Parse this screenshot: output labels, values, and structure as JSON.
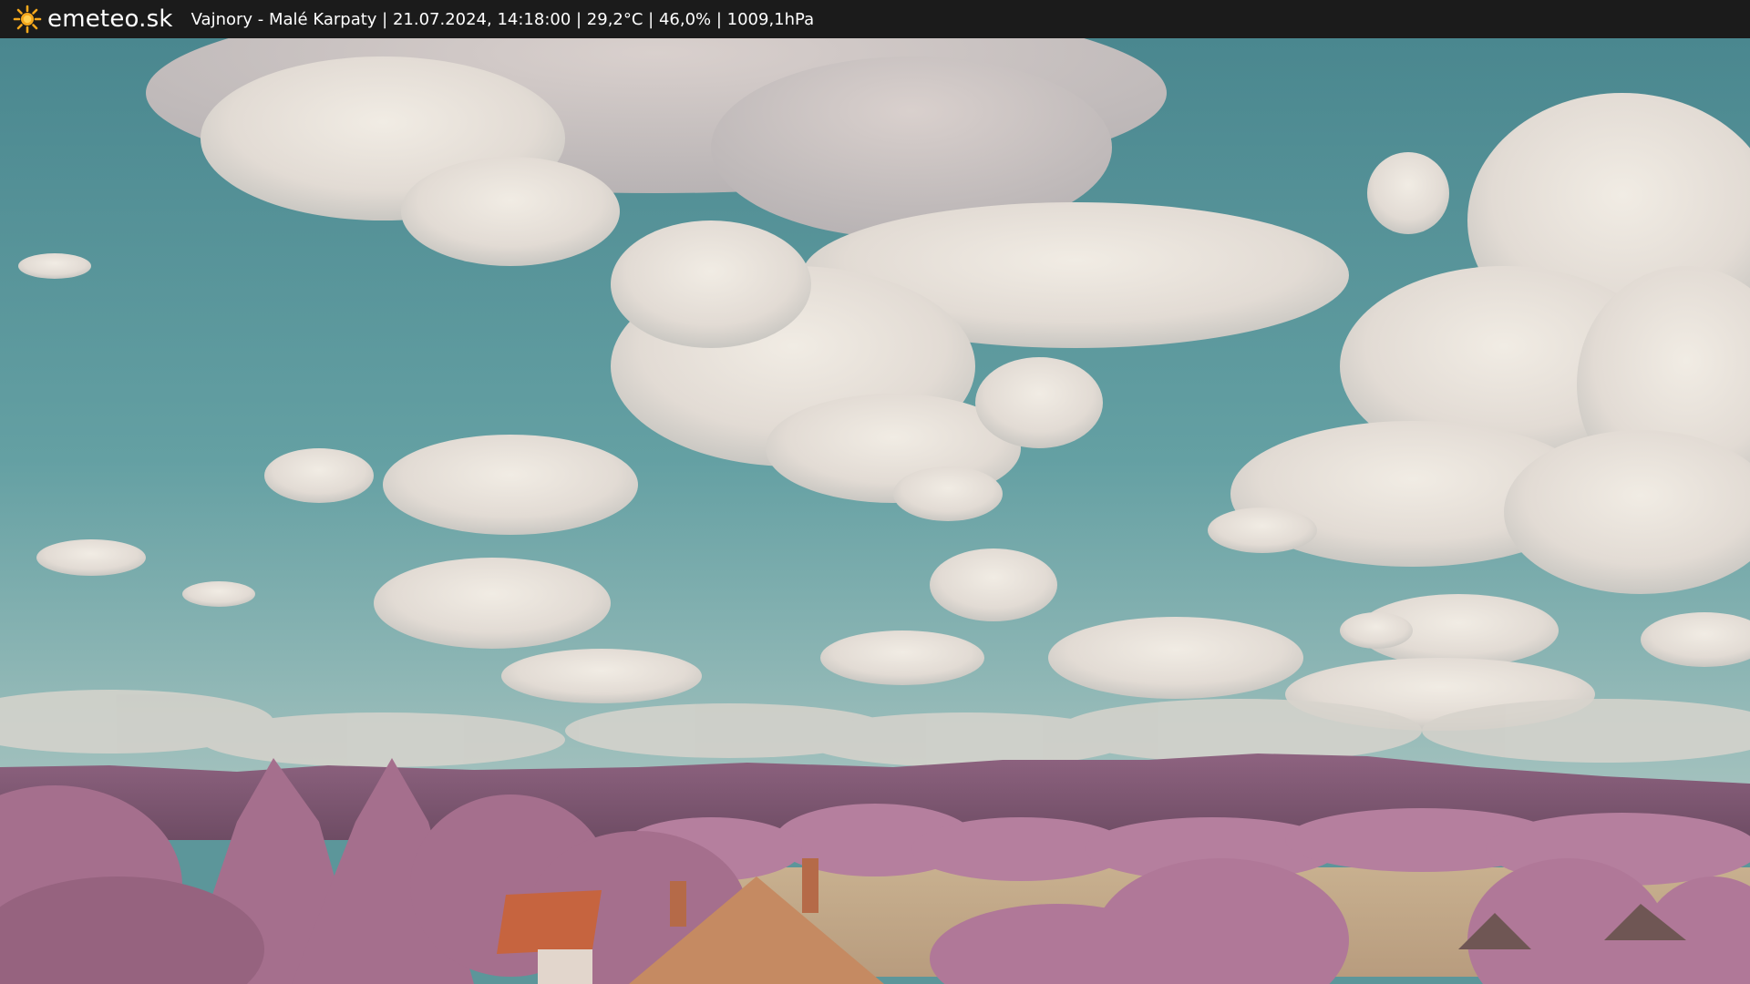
{
  "header": {
    "brand": "emeteo.sk",
    "brand_icon": "sun-icon",
    "brand_color": "#f5a81c",
    "caption": "Vajnory - Malé Karpaty | 21.07.2024, 14:18:00 | 29,2°C | 46,0% | 1009,1hPa"
  },
  "webcam": {
    "description_icon": "webcam-image",
    "colors": {
      "sky_top": "#4d8a91",
      "sky_bottom": "#8cb5b2",
      "cloud": "#e9e3dc",
      "hills": "#8a5d77",
      "foliage": "#b07898",
      "roof": "#c6643f"
    }
  }
}
